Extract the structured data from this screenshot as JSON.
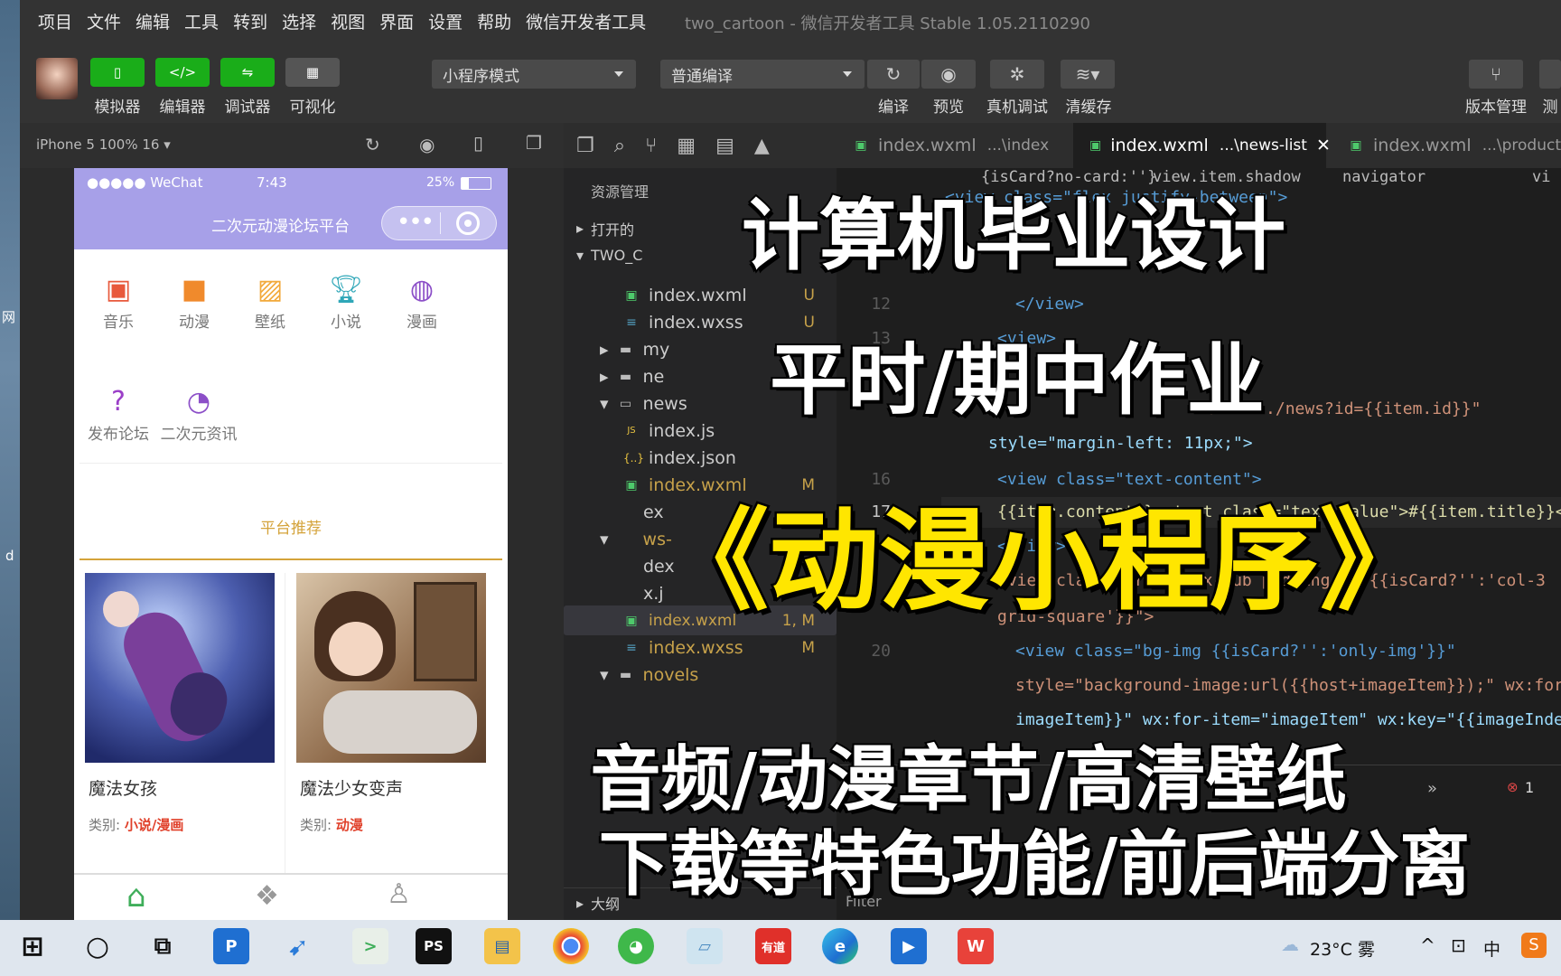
{
  "window": {
    "title": "two_cartoon - 微信开发者工具 Stable 1.05.2110290"
  },
  "menu": [
    "项目",
    "文件",
    "编辑",
    "工具",
    "转到",
    "选择",
    "视图",
    "界面",
    "设置",
    "帮助",
    "微信开发者工具"
  ],
  "toolbar": {
    "simulator": "模拟器",
    "editor": "编辑器",
    "debugger": "调试器",
    "visual": "可视化",
    "mode_select": "小程序模式",
    "compile_select": "普通编译",
    "compile": "编译",
    "preview": "预览",
    "real_debug": "真机调试",
    "clear_cache": "清缓存",
    "version": "版本管理",
    "test": "测"
  },
  "simulator": {
    "device": "iPhone 5 100% 16 ▾",
    "status": {
      "carrier": "●●●●● WeChat",
      "time": "7:43",
      "battery": "25%"
    },
    "nav_title": "二次元动漫论坛平台",
    "categories": [
      {
        "label": "音乐",
        "icon": "vr-glasses-icon",
        "color": "#e8593c"
      },
      {
        "label": "动漫",
        "icon": "video-camera-icon",
        "color": "#f08a2c"
      },
      {
        "label": "壁纸",
        "icon": "picture-icon",
        "color": "#f2a93b"
      },
      {
        "label": "小说",
        "icon": "trophy-icon",
        "color": "#2fa7b8"
      },
      {
        "label": "漫画",
        "icon": "planet-icon",
        "color": "#8c4fc8"
      },
      {
        "label": "发布论坛",
        "icon": "question-icon",
        "color": "#9b3fc8"
      },
      {
        "label": "二次元资讯",
        "icon": "chat-bubble-icon",
        "color": "#8c4fc8"
      }
    ],
    "section_title": "平台推荐",
    "cards": [
      {
        "title": "魔法女孩",
        "category_label": "类别:",
        "category_value": "小说/漫画"
      },
      {
        "title": "魔法少女变声",
        "category_label": "类别:",
        "category_value": "动漫"
      }
    ]
  },
  "explorer": {
    "header": "资源管理",
    "open_editors": "打开的",
    "project": "TWO_C",
    "rows": [
      {
        "label": "index.wxml",
        "mark": "U",
        "icon": "wxml"
      },
      {
        "label": "index.wxss",
        "mark": "U",
        "icon": "wxss"
      },
      {
        "label": "my",
        "mark": "",
        "icon": "folder"
      },
      {
        "label": "ne",
        "mark": "",
        "icon": "folder"
      },
      {
        "label": "news",
        "mark": "",
        "icon": "folder-open"
      },
      {
        "label": "index.js",
        "mark": "",
        "icon": "js"
      },
      {
        "label": "index.json",
        "mark": "",
        "icon": "json"
      },
      {
        "label": "index.wxml",
        "mark": "M",
        "icon": "wxml"
      },
      {
        "label": "ex",
        "mark": "",
        "icon": "none"
      },
      {
        "label": "ws-",
        "mark": "",
        "icon": "none"
      },
      {
        "label": "dex",
        "mark": "",
        "icon": "none"
      },
      {
        "label": "x.j",
        "mark": "",
        "icon": "none"
      },
      {
        "label": "index.wxml",
        "mark": "1, M",
        "icon": "wxml"
      },
      {
        "label": "index.wxss",
        "mark": "M",
        "icon": "wxss"
      },
      {
        "label": "novels",
        "mark": "",
        "icon": "folder"
      }
    ],
    "outline": "大纲"
  },
  "tabs": [
    {
      "name": "index.wxml",
      "path": "...\\index"
    },
    {
      "name": "index.wxml",
      "path": "...\\news-list"
    },
    {
      "name": "index.wxml",
      "path": "...\\product"
    }
  ],
  "breadcrumb": {
    "a": "{isCard?no-card:''}",
    "b": "view.item.shadow",
    "c": "navigator",
    "d": "vi"
  },
  "code": [
    {
      "ln": "",
      "text": "<view class=\"flex justify-between\">"
    },
    {
      "ln": "12",
      "text": "</view>"
    },
    {
      "ln": "13",
      "text": "<view>"
    },
    {
      "ln": "",
      "text": "url=\"../news?id={{item.id}}\""
    },
    {
      "ln": "",
      "text": "style=\"margin-left: 11px;\">"
    },
    {
      "ln": "16",
      "text": "<view class=\"text-content\">"
    },
    {
      "ln": "17",
      "text": "{{item.content}} <text class=\"text-value\">#{{item.title}}</"
    },
    {
      "ln": "",
      "text": "</view>"
    },
    {
      "ln": "",
      "text": "<view class=\"grid flex-sub padding-xs {{isCard?'':'col-3"
    },
    {
      "ln": "",
      "text": "grid-square'}}\">"
    },
    {
      "ln": "20",
      "text": "<view class=\"bg-img {{isCard?'':'only-img'}}\""
    },
    {
      "ln": "",
      "text": "style=\"background-image:url({{host+imageItem}});\" wx:for"
    },
    {
      "ln": "",
      "text": "imageItem}}\" wx:for-item=\"imageItem\" wx:key=\"{{imageIndex}}"
    }
  ],
  "panel": {
    "filter": "Filter",
    "errors": "1"
  },
  "overlay": {
    "line1": "计算机毕业设计",
    "line2": "平时/期中作业",
    "line3": "《动漫小程序》",
    "line4": "音频/动漫章节/高清壁纸",
    "line5": "下载等特色功能/前后端分离"
  },
  "taskbar": {
    "weather": "23°C 雾",
    "ime": "中",
    "apps": [
      "windows-start-icon",
      "cortana-icon",
      "task-view-icon",
      "p-app-icon",
      "dolphin-icon",
      "wechat-devtools-icon",
      "pycharm-icon",
      "file-explorer-icon",
      "chrome-icon",
      "wechat-icon",
      "notepad-icon",
      "youdao-icon",
      "edge-icon",
      "media-icon",
      "wps-icon"
    ],
    "youdao": "有道"
  },
  "desktop_side": {
    "a": "网",
    "b": "d"
  },
  "colors": {
    "wechat_green": "#1aad19",
    "nav_purple": "#a7a0e8",
    "overlay_yellow": "#ffe600",
    "accent_orange": "#d4a33a",
    "category_red": "#e0402a"
  }
}
